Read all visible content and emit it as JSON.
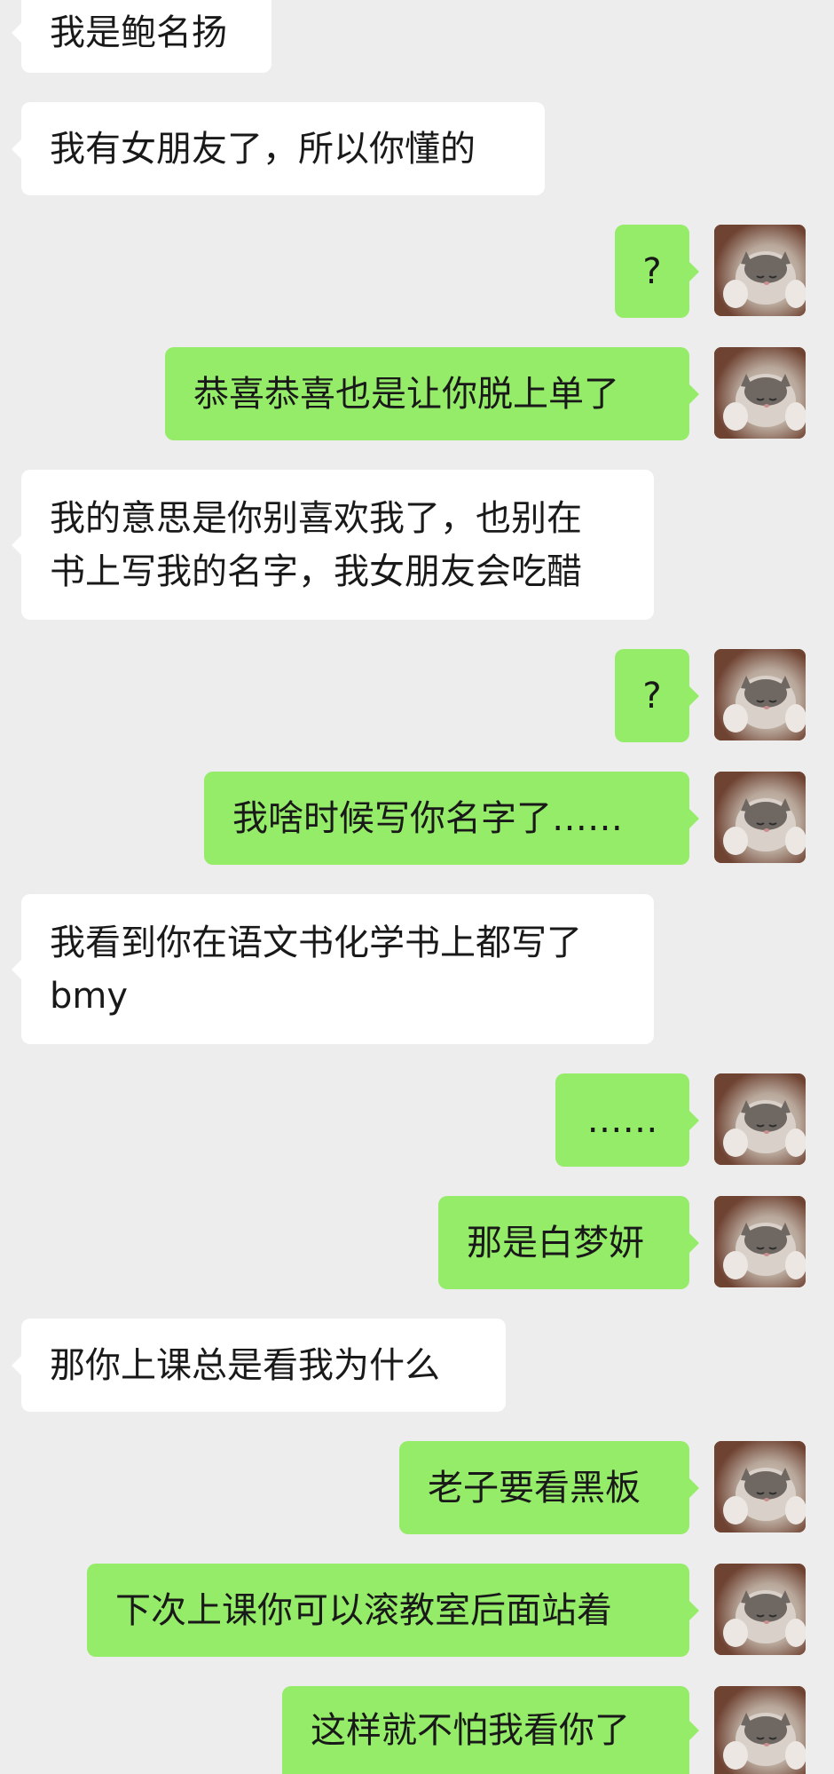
{
  "chat": {
    "messages": [
      {
        "side": "left",
        "lines": [
          "我是鲍名扬"
        ]
      },
      {
        "side": "left",
        "lines": [
          "我有女朋友了，所以你懂的"
        ]
      },
      {
        "side": "right",
        "lines": [
          "?"
        ]
      },
      {
        "side": "right",
        "lines": [
          "恭喜恭喜也是让你脱上单了"
        ]
      },
      {
        "side": "left",
        "lines": [
          "我的意思是你别喜欢我了，也别在",
          "书上写我的名字，我女朋友会吃醋"
        ]
      },
      {
        "side": "right",
        "lines": [
          "?"
        ]
      },
      {
        "side": "right",
        "lines": [
          "我啥时候写你名字了……"
        ]
      },
      {
        "side": "left",
        "lines": [
          "我看到你在语文书化学书上都写了",
          "bmy"
        ]
      },
      {
        "side": "right",
        "lines": [
          "……"
        ]
      },
      {
        "side": "right",
        "lines": [
          "那是白梦妍"
        ]
      },
      {
        "side": "left",
        "lines": [
          "那你上课总是看我为什么"
        ]
      },
      {
        "side": "right",
        "lines": [
          "老子要看黑板"
        ]
      },
      {
        "side": "right",
        "lines": [
          "下次上课你可以滚教室后面站着"
        ]
      },
      {
        "side": "right",
        "lines": [
          "这样就不怕我看你了"
        ]
      }
    ],
    "avatar_icon": "kitten-avatar-icon",
    "colors": {
      "background": "#ededed",
      "incoming_bubble": "#ffffff",
      "outgoing_bubble": "#95ec69",
      "text": "#191919"
    }
  }
}
